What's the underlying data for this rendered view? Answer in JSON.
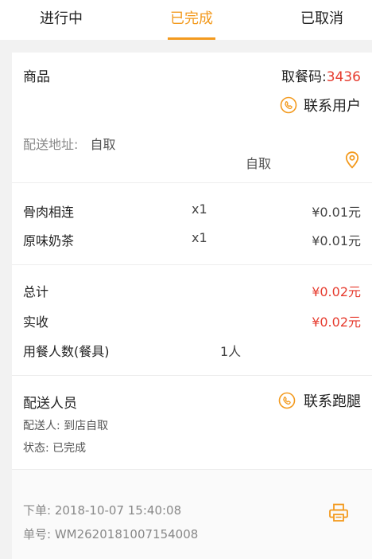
{
  "tabs": [
    {
      "label": "进行中"
    },
    {
      "label": "已完成"
    },
    {
      "label": "已取消"
    }
  ],
  "order": {
    "goods_label": "商品",
    "pickup_code_label": "取餐码:",
    "pickup_code": "3436",
    "contact_user_label": "联系用户",
    "address_label": "配送地址:",
    "address_value": "自取",
    "address_detail": "自取",
    "items": [
      {
        "name": "骨肉相连",
        "qty": "x1",
        "price": "¥0.01元"
      },
      {
        "name": "原味奶茶",
        "qty": "x1",
        "price": "¥0.01元"
      }
    ],
    "total_label": "总计",
    "total_value": "¥0.02元",
    "received_label": "实收",
    "received_value": "¥0.02元",
    "diners_label": "用餐人数(餐具)",
    "diners_value": "1人"
  },
  "delivery": {
    "title": "配送人员",
    "contact_runner_label": "联系跑腿",
    "courier_line": "配送人: 到店自取",
    "status_line": "状态: 已完成"
  },
  "footer": {
    "order_time": "下单: 2018-10-07 15:40:08",
    "order_no": "单号: WM2620181007154008"
  },
  "colors": {
    "accent": "#f39a1e",
    "price_red": "#e63b2e",
    "background": "#f2f2f2"
  },
  "icons": [
    "phone-icon",
    "location-pin-icon",
    "printer-icon"
  ]
}
